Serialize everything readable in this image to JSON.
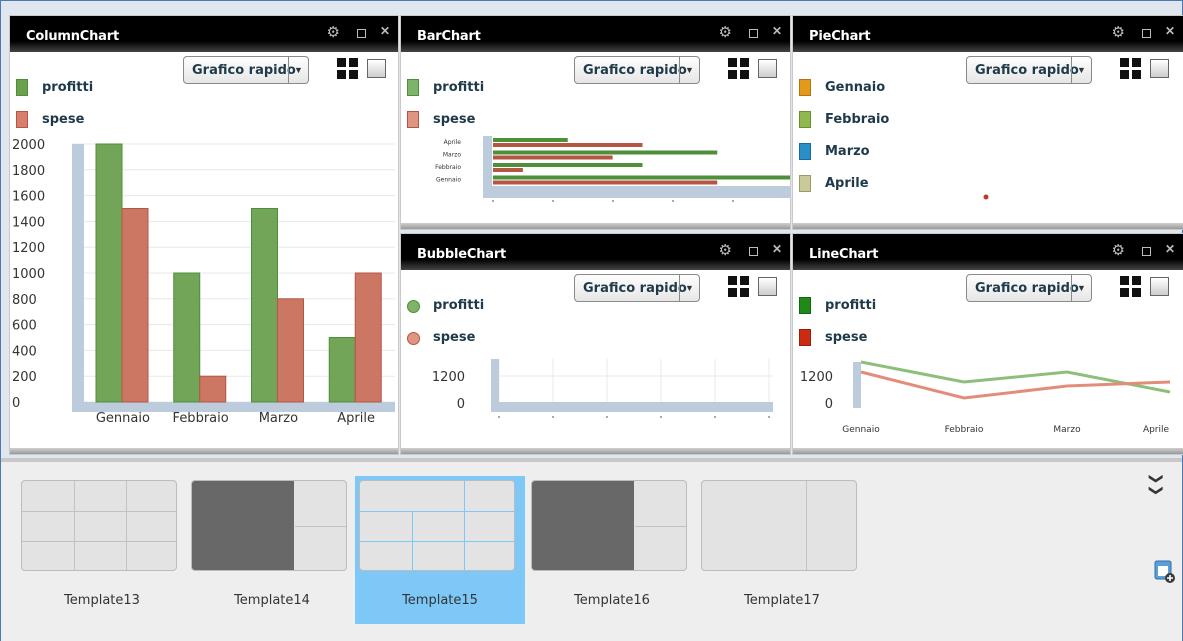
{
  "quick_label": "Grafico rapido",
  "colors": {
    "profitti": "#4e8f3a",
    "spese": "#b55643",
    "header": "#000000",
    "selected_template": "#7ec8f8"
  },
  "panels": {
    "column": {
      "title": "ColumnChart",
      "legend": [
        "profitti",
        "spese"
      ]
    },
    "bar": {
      "title": "BarChart",
      "legend": [
        "profitti",
        "spese"
      ]
    },
    "pie": {
      "title": "PieChart",
      "legend": [
        "Gennaio",
        "Febbraio",
        "Marzo",
        "Aprile"
      ]
    },
    "bubble": {
      "title": "BubbleChart",
      "legend": [
        "profitti",
        "spese"
      ]
    },
    "line": {
      "title": "LineChart",
      "legend": [
        "profitti",
        "spese"
      ]
    }
  },
  "chart_data": [
    {
      "type": "bar",
      "title": "ColumnChart",
      "categories": [
        "Gennaio",
        "Febbraio",
        "Marzo",
        "Aprile"
      ],
      "series": [
        {
          "name": "profitti",
          "values": [
            2000,
            1000,
            1500,
            500
          ]
        },
        {
          "name": "spese",
          "values": [
            1500,
            200,
            800,
            1000
          ]
        }
      ],
      "yticks": [
        "2000",
        "1800",
        "1600",
        "1400",
        "1200",
        "1000",
        "800",
        "600",
        "400",
        "200",
        "0"
      ],
      "ylim": [
        0,
        2000
      ]
    },
    {
      "type": "bar",
      "orientation": "horizontal",
      "title": "BarChart",
      "categories": [
        "Aprile",
        "Marzo",
        "Febbraio",
        "Gennaio"
      ],
      "series": [
        {
          "name": "profitti",
          "values": [
            500,
            1500,
            1000,
            2000
          ]
        },
        {
          "name": "spese",
          "values": [
            1000,
            800,
            200,
            1500
          ]
        }
      ],
      "xlim": [
        0,
        2000
      ]
    },
    {
      "type": "pie",
      "title": "PieChart",
      "categories": [
        "Gennaio",
        "Febbraio",
        "Marzo",
        "Aprile"
      ]
    },
    {
      "type": "scatter",
      "title": "BubbleChart",
      "series": [
        {
          "name": "profitti"
        },
        {
          "name": "spese"
        }
      ],
      "yticks": [
        "1200",
        "0"
      ]
    },
    {
      "type": "line",
      "title": "LineChart",
      "categories": [
        "Gennaio",
        "Febbraio",
        "Marzo",
        "Aprile"
      ],
      "series": [
        {
          "name": "profitti",
          "values": [
            2000,
            1000,
            1500,
            500
          ]
        },
        {
          "name": "spese",
          "values": [
            1500,
            200,
            800,
            1000
          ]
        }
      ],
      "yticks": [
        "1200",
        "0"
      ],
      "ylim": [
        0,
        2000
      ]
    }
  ],
  "templates": [
    {
      "name": "Template13",
      "selected": false
    },
    {
      "name": "Template14",
      "selected": false
    },
    {
      "name": "Template15",
      "selected": true
    },
    {
      "name": "Template16",
      "selected": false
    },
    {
      "name": "Template17",
      "selected": false
    }
  ]
}
